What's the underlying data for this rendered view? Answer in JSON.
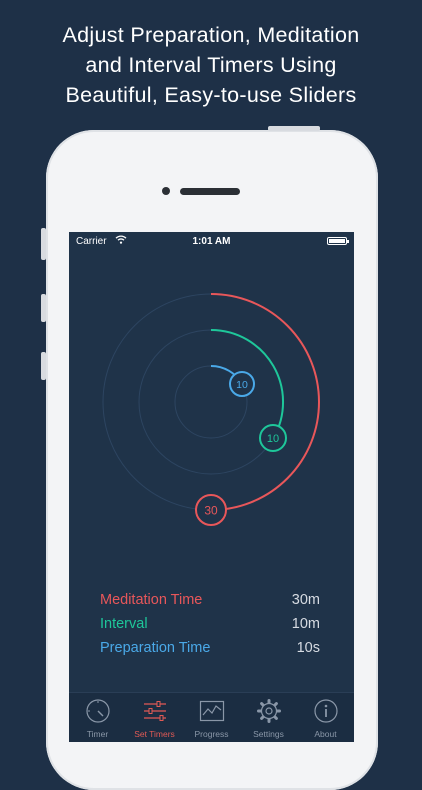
{
  "headline": {
    "line1": "Adjust Preparation, Meditation",
    "line2": "and Interval Timers Using",
    "line3": "Beautiful, Easy-to-use Sliders"
  },
  "status_bar": {
    "carrier": "Carrier",
    "time": "1:01 AM"
  },
  "dial": {
    "meditation_knob": "30",
    "interval_knob": "10",
    "preparation_knob": "10",
    "colors": {
      "meditation": "#e8575a",
      "interval": "#1ec79a",
      "preparation": "#4aa9e8"
    }
  },
  "settings": [
    {
      "label": "Meditation Time",
      "value": "30m",
      "color": "#e8575a"
    },
    {
      "label": "Interval",
      "value": "10m",
      "color": "#1ec79a"
    },
    {
      "label": "Preparation Time",
      "value": "10s",
      "color": "#4aa9e8"
    }
  ],
  "tabs": [
    {
      "label": "Timer",
      "icon": "stopwatch-icon",
      "active": false
    },
    {
      "label": "Set Timers",
      "icon": "sliders-icon",
      "active": true
    },
    {
      "label": "Progress",
      "icon": "chart-icon",
      "active": false
    },
    {
      "label": "Settings",
      "icon": "gear-icon",
      "active": false
    },
    {
      "label": "About",
      "icon": "info-icon",
      "active": false
    }
  ]
}
